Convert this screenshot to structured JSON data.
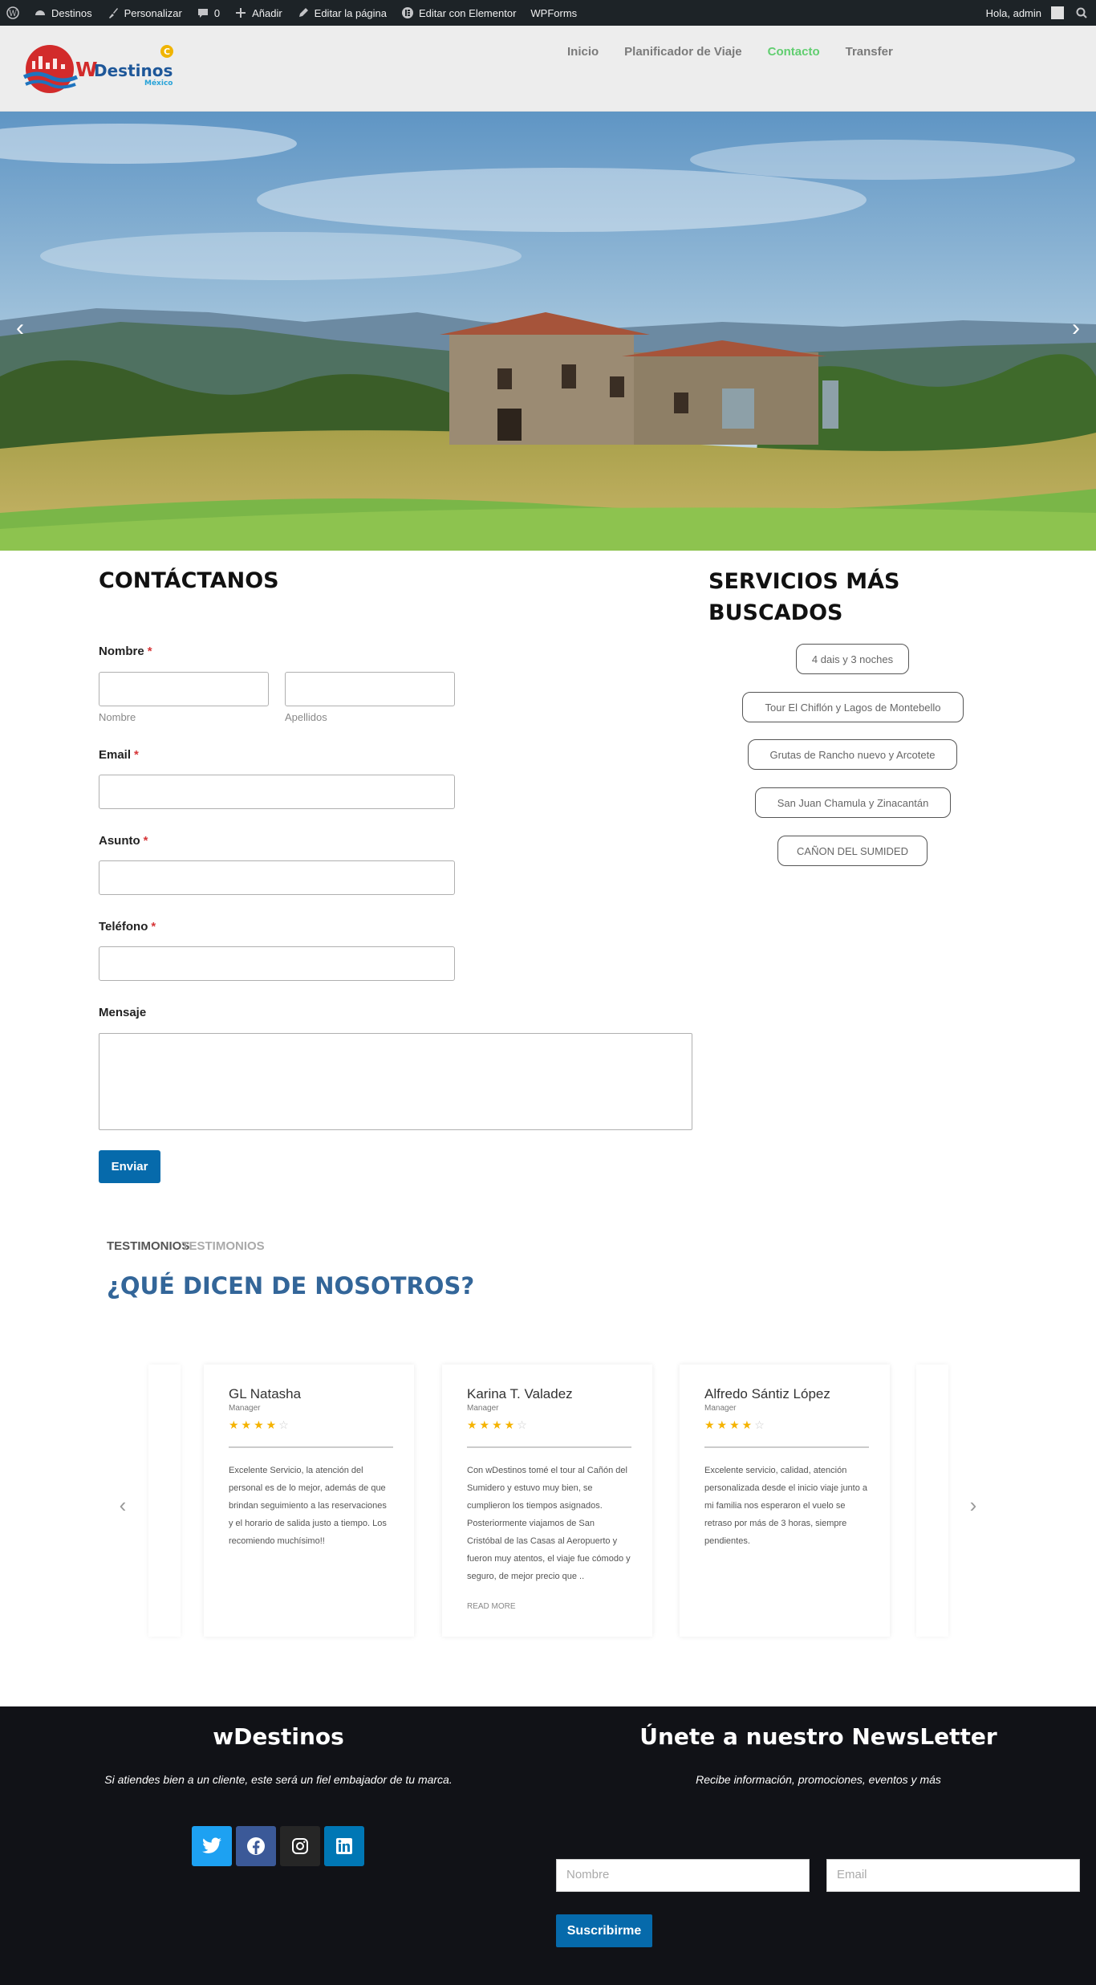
{
  "adminbar": {
    "items": [
      {
        "icon": "wordpress-icon",
        "label": ""
      },
      {
        "icon": "dashboard-icon",
        "label": "Destinos"
      },
      {
        "icon": "brush-icon",
        "label": "Personalizar"
      },
      {
        "icon": "comment-icon",
        "label": "0"
      },
      {
        "icon": "plus-icon",
        "label": "Añadir"
      },
      {
        "icon": "pencil-icon",
        "label": "Editar la página"
      },
      {
        "icon": "elementor-icon",
        "label": "Editar con Elementor"
      },
      {
        "icon": "",
        "label": "WPForms"
      }
    ],
    "greeting": "Hola, admin"
  },
  "header": {
    "logo_text": "WDestinos",
    "logo_sub": "México",
    "nav": [
      {
        "label": "Inicio",
        "active": false
      },
      {
        "label": "Planificador de Viaje",
        "active": false
      },
      {
        "label": "Contacto",
        "active": true
      },
      {
        "label": "Transfer",
        "active": false
      }
    ]
  },
  "contact": {
    "title": "CONTÁCTANOS",
    "fields": {
      "nombre_label": "Nombre",
      "nombre_sub": "Nombre",
      "apellidos_sub": "Apellidos",
      "email_label": "Email",
      "asunto_label": "Asunto",
      "telefono_label": "Teléfono",
      "mensaje_label": "Mensaje",
      "required_mark": "*"
    },
    "submit_label": "Enviar"
  },
  "services": {
    "title": "SERVICIOS MÁS BUSCADOS",
    "items": [
      "4 dais y 3 noches",
      "Tour El Chiflón y Lagos de Montebello",
      "Grutas de Rancho nuevo y Arcotete",
      "San Juan Chamula y Zinacantán",
      "CAÑON DEL SUMIDED"
    ]
  },
  "testimonials": {
    "tag": "TESTIMONIOS",
    "tag_ghost": "TESTIMONIOS",
    "title": "¿QUÉ DICEN DE NOSOTROS?",
    "cards": [
      {
        "name": "GL Natasha",
        "role": "Manager",
        "rating": 4,
        "text": "Excelente Servicio, la atención del personal es de lo mejor, además de que brindan seguimiento a las reservaciones y el horario de salida justo a tiempo. Los recomiendo muchísimo!!",
        "more": ""
      },
      {
        "name": "Karina T. Valadez",
        "role": "Manager",
        "rating": 4,
        "text": "Con wDestinos tomé el tour al Cañón del Sumidero y estuvo muy bien, se cumplieron los tiempos asignados. Posteriormente viajamos de San Cristóbal de las Casas al Aeropuerto y fueron muy atentos, el viaje fue cómodo y seguro, de mejor precio que ..",
        "more": "READ MORE"
      },
      {
        "name": "Alfredo Sántiz López",
        "role": "Manager",
        "rating": 4,
        "text": "Excelente servicio, calidad, atención personalizada desde el inicio viaje junto a mi familia nos esperaron el vuelo se retraso por más de 3 horas, siempre pendientes.",
        "more": ""
      }
    ]
  },
  "footer": {
    "brand": "wDestinos",
    "brand_tagline": "Si atiendes bien a un cliente, este será un fiel embajador de tu marca.",
    "social": [
      {
        "icon": "twitter-icon",
        "color": "#1da1f2"
      },
      {
        "icon": "facebook-icon",
        "color": "#3b5998"
      },
      {
        "icon": "instagram-icon",
        "color": "#262626"
      },
      {
        "icon": "linkedin-icon",
        "color": "#0077b5"
      }
    ],
    "newsletter_title": "Únete a nuestro NewsLetter",
    "newsletter_tagline": "Recibe información, promociones, eventos y más",
    "nombre_placeholder": "Nombre",
    "email_placeholder": "Email",
    "subscribe_label": "Suscribirme"
  },
  "colors": {
    "adminbar": "#1d2327",
    "nav_active": "#61ce70",
    "button": "#066aab",
    "testimonial_title": "#336699",
    "star": "#f5b301",
    "footer_bg": "#111217"
  }
}
